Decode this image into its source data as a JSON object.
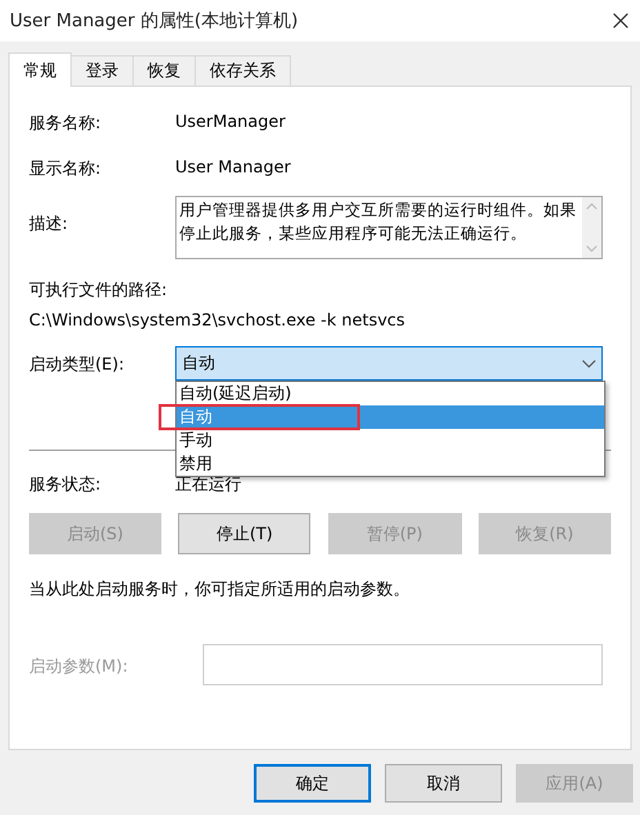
{
  "window": {
    "title": "User Manager 的属性(本地计算机)"
  },
  "tabs": [
    {
      "label": "常规",
      "selected": true
    },
    {
      "label": "登录",
      "selected": false
    },
    {
      "label": "恢复",
      "selected": false
    },
    {
      "label": "依存关系",
      "selected": false
    }
  ],
  "service_name": {
    "label": "服务名称:",
    "value": "UserManager"
  },
  "display_name": {
    "label": "显示名称:",
    "value": "User Manager"
  },
  "description": {
    "label": "描述:",
    "value": "用户管理器提供多用户交互所需要的运行时组件。如果停止此服务，某些应用程序可能无法正确运行。"
  },
  "executable": {
    "label": "可执行文件的路径:",
    "value": "C:\\Windows\\system32\\svchost.exe -k netsvcs"
  },
  "startup_type": {
    "label": "启动类型(E):",
    "value": "自动",
    "expanded": true,
    "options": [
      {
        "label": "自动(延迟启动)",
        "selected": false
      },
      {
        "label": "自动",
        "selected": true
      },
      {
        "label": "手动",
        "selected": false
      },
      {
        "label": "禁用",
        "selected": false
      }
    ]
  },
  "service_status": {
    "label": "服务状态:",
    "value": "正在运行"
  },
  "service_buttons": [
    {
      "label": "启动(S)",
      "disabled": true
    },
    {
      "label": "停止(T)",
      "disabled": false
    },
    {
      "label": "暂停(P)",
      "disabled": true
    },
    {
      "label": "恢复(R)",
      "disabled": true
    }
  ],
  "hint": "当从此处启动服务时，你可指定所适用的启动参数。",
  "start_params": {
    "label": "启动参数(M):",
    "disabled": true
  },
  "dialog_buttons": [
    {
      "label": "确定",
      "disabled": false,
      "default": true
    },
    {
      "label": "取消",
      "disabled": false,
      "default": false
    },
    {
      "label": "应用(A)",
      "disabled": true,
      "default": false
    }
  ]
}
